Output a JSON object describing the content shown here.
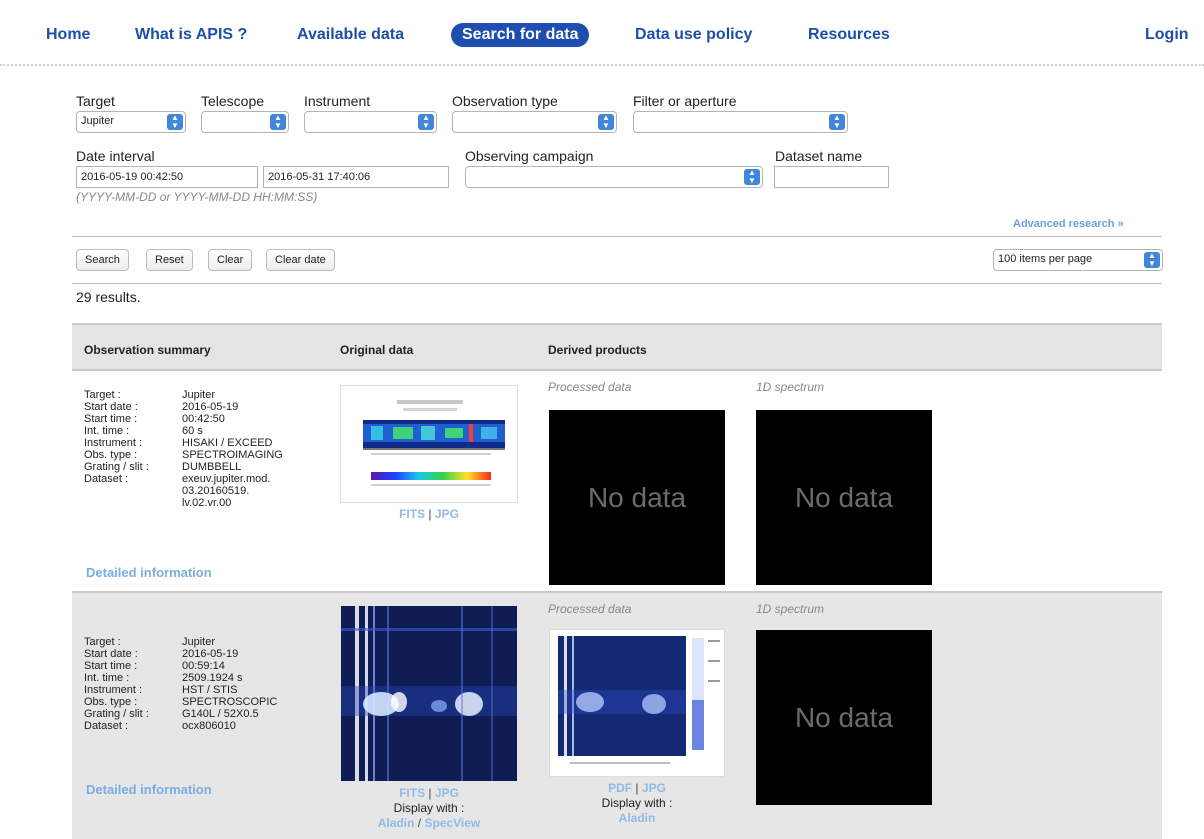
{
  "nav": {
    "home": "Home",
    "what": "What is APIS ?",
    "available": "Available data",
    "search": "Search for data",
    "policy": "Data use policy",
    "resources": "Resources",
    "login": "Login"
  },
  "form": {
    "target_label": "Target",
    "target_value": "Jupiter",
    "telescope_label": "Telescope",
    "telescope_value": "",
    "instrument_label": "Instrument",
    "instrument_value": "",
    "obstype_label": "Observation type",
    "obstype_value": "",
    "filter_label": "Filter or aperture",
    "filter_value": "",
    "date_label": "Date interval",
    "date_start": "2016-05-19 00:42:50",
    "date_end": "2016-05-31 17:40:06",
    "date_hint": "(YYYY-MM-DD or YYYY-MM-DD HH:MM:SS)",
    "campaign_label": "Observing campaign",
    "campaign_value": "",
    "dataset_label": "Dataset name",
    "dataset_value": "",
    "advanced": "Advanced research »"
  },
  "buttons": {
    "search": "Search",
    "reset": "Reset",
    "clear": "Clear",
    "clear_date": "Clear date"
  },
  "per_page": "100 items per page",
  "results": "29 results.",
  "table": {
    "col_summary": "Observation summary",
    "col_original": "Original data",
    "col_derived": "Derived products",
    "processed_label": "Processed data",
    "spectrum_label": "1D spectrum",
    "nodata": "No data",
    "detail": "Detailed information",
    "display_with": "Display with :",
    "rows": [
      {
        "fields": [
          {
            "k": "Target :",
            "v": "Jupiter"
          },
          {
            "k": "Start date :",
            "v": "2016-05-19"
          },
          {
            "k": "Start time :",
            "v": "00:42:50"
          },
          {
            "k": "Int. time :",
            "v": "60 s"
          },
          {
            "k": "Instrument :",
            "v": "HISAKI / EXCEED"
          },
          {
            "k": "Obs. type :",
            "v": "SPECTROIMAGING"
          },
          {
            "k": "Grating / slit :",
            "v": "DUMBBELL"
          },
          {
            "k": "Dataset :",
            "v": "exeuv.jupiter.mod."
          }
        ],
        "dataset_cont1": "03.20160519.",
        "dataset_cont2": "lv.02.vr.00",
        "original_links": [
          "FITS",
          "JPG"
        ]
      },
      {
        "fields": [
          {
            "k": "Target :",
            "v": "Jupiter"
          },
          {
            "k": "Start date :",
            "v": "2016-05-19"
          },
          {
            "k": "Start time :",
            "v": "00:59:14"
          },
          {
            "k": "Int. time :",
            "v": "2509.1924 s"
          },
          {
            "k": "Instrument :",
            "v": "HST / STIS"
          },
          {
            "k": "Obs. type :",
            "v": "SPECTROSCOPIC"
          },
          {
            "k": "Grating / slit :",
            "v": "G140L / 52X0.5"
          },
          {
            "k": "Dataset :",
            "v": "ocx806010"
          }
        ],
        "original_links": [
          "FITS",
          "JPG"
        ],
        "original_viewers": [
          "Aladin",
          "SpecView"
        ],
        "processed_links": [
          "PDF",
          "JPG"
        ],
        "processed_viewers": [
          "Aladin"
        ]
      }
    ]
  }
}
